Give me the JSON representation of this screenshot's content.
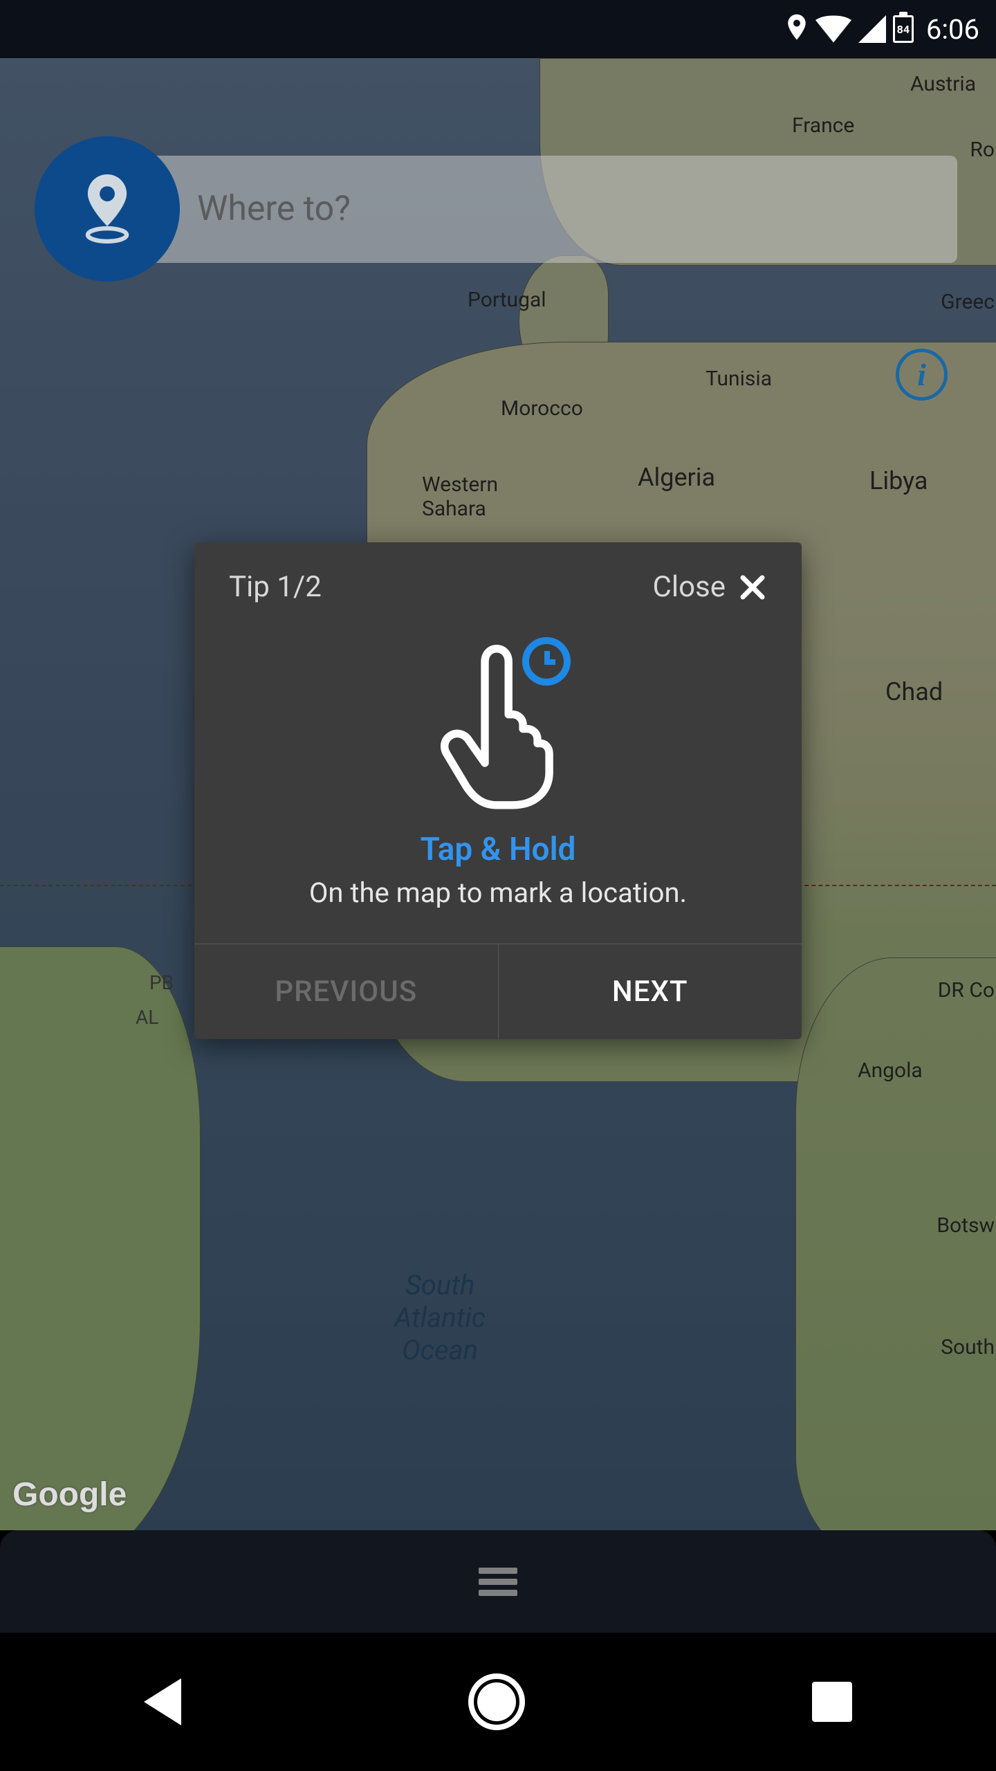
{
  "status": {
    "time": "6:06",
    "battery": "84"
  },
  "search": {
    "placeholder": "Where to?"
  },
  "map_labels": {
    "france": "France",
    "austria": "Austria",
    "ro": "Ro",
    "portugal": "Portugal",
    "greec": "Greec",
    "tunisia": "Tunisia",
    "morocco": "Morocco",
    "western_sahara": "Western\nSahara",
    "algeria": "Algeria",
    "libya": "Libya",
    "chad": "Chad",
    "pb": "PB",
    "al": "AL",
    "drco": "DR Co",
    "angola": "Angola",
    "botsw": "Botsw",
    "south": "South",
    "sao": "South\nAtlantic\nOcean",
    "google": "Google"
  },
  "tip": {
    "counter": "Tip 1/2",
    "close": "Close",
    "title": "Tap & Hold",
    "desc": "On the map to mark a location.",
    "prev": "PREVIOUS",
    "next": "NEXT"
  }
}
